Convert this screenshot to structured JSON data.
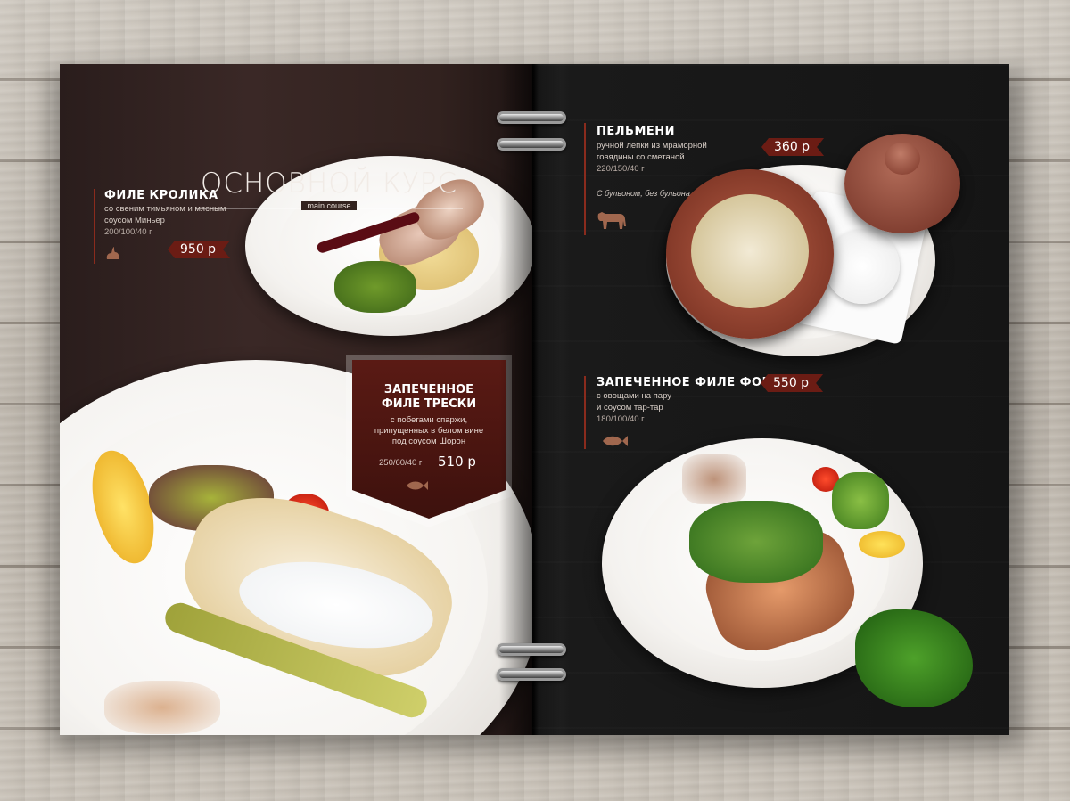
{
  "menu": {
    "section_title": "ОСНОВНОЙ КУРС",
    "section_subtitle": "main course"
  },
  "dishes": {
    "rabbit": {
      "name": "ФИЛЕ КРОЛИКА",
      "desc_line1": "со свеним тимьяном и мясным",
      "desc_line2": "соусом Миньер",
      "weight": "200/100/40 г",
      "price": "950 р",
      "icon": "rabbit-icon"
    },
    "cod": {
      "name_line1": "ЗАПЕЧЕННОЕ",
      "name_line2": "ФИЛЕ ТРЕСКИ",
      "desc_line1": "с побегами спаржи,",
      "desc_line2": "припущенных в белом вине",
      "desc_line3": "под соусом Шорон",
      "weight": "250/60/40 г",
      "price": "510 р",
      "icon": "fish-icon"
    },
    "pelmeni": {
      "name": "ПЕЛЬМЕНИ",
      "desc_line1": "ручной лепки из мраморной",
      "desc_line2": "говядины со сметаной",
      "weight": "220/150/40 г",
      "note": "С бульоном, без бульона",
      "price": "360 р",
      "icon": "cow-icon"
    },
    "trout": {
      "name": "ЗАПЕЧЕННОЕ ФИЛЕ ФОРЕЛИ",
      "desc_line1": "с овощами на пару",
      "desc_line2": "и соусом тар-тар",
      "weight": "180/100/40 г",
      "price": "550 р",
      "icon": "fish-icon"
    }
  },
  "colors": {
    "accent": "#6b1c14",
    "left_page": "#33231f",
    "right_page": "#151515"
  }
}
